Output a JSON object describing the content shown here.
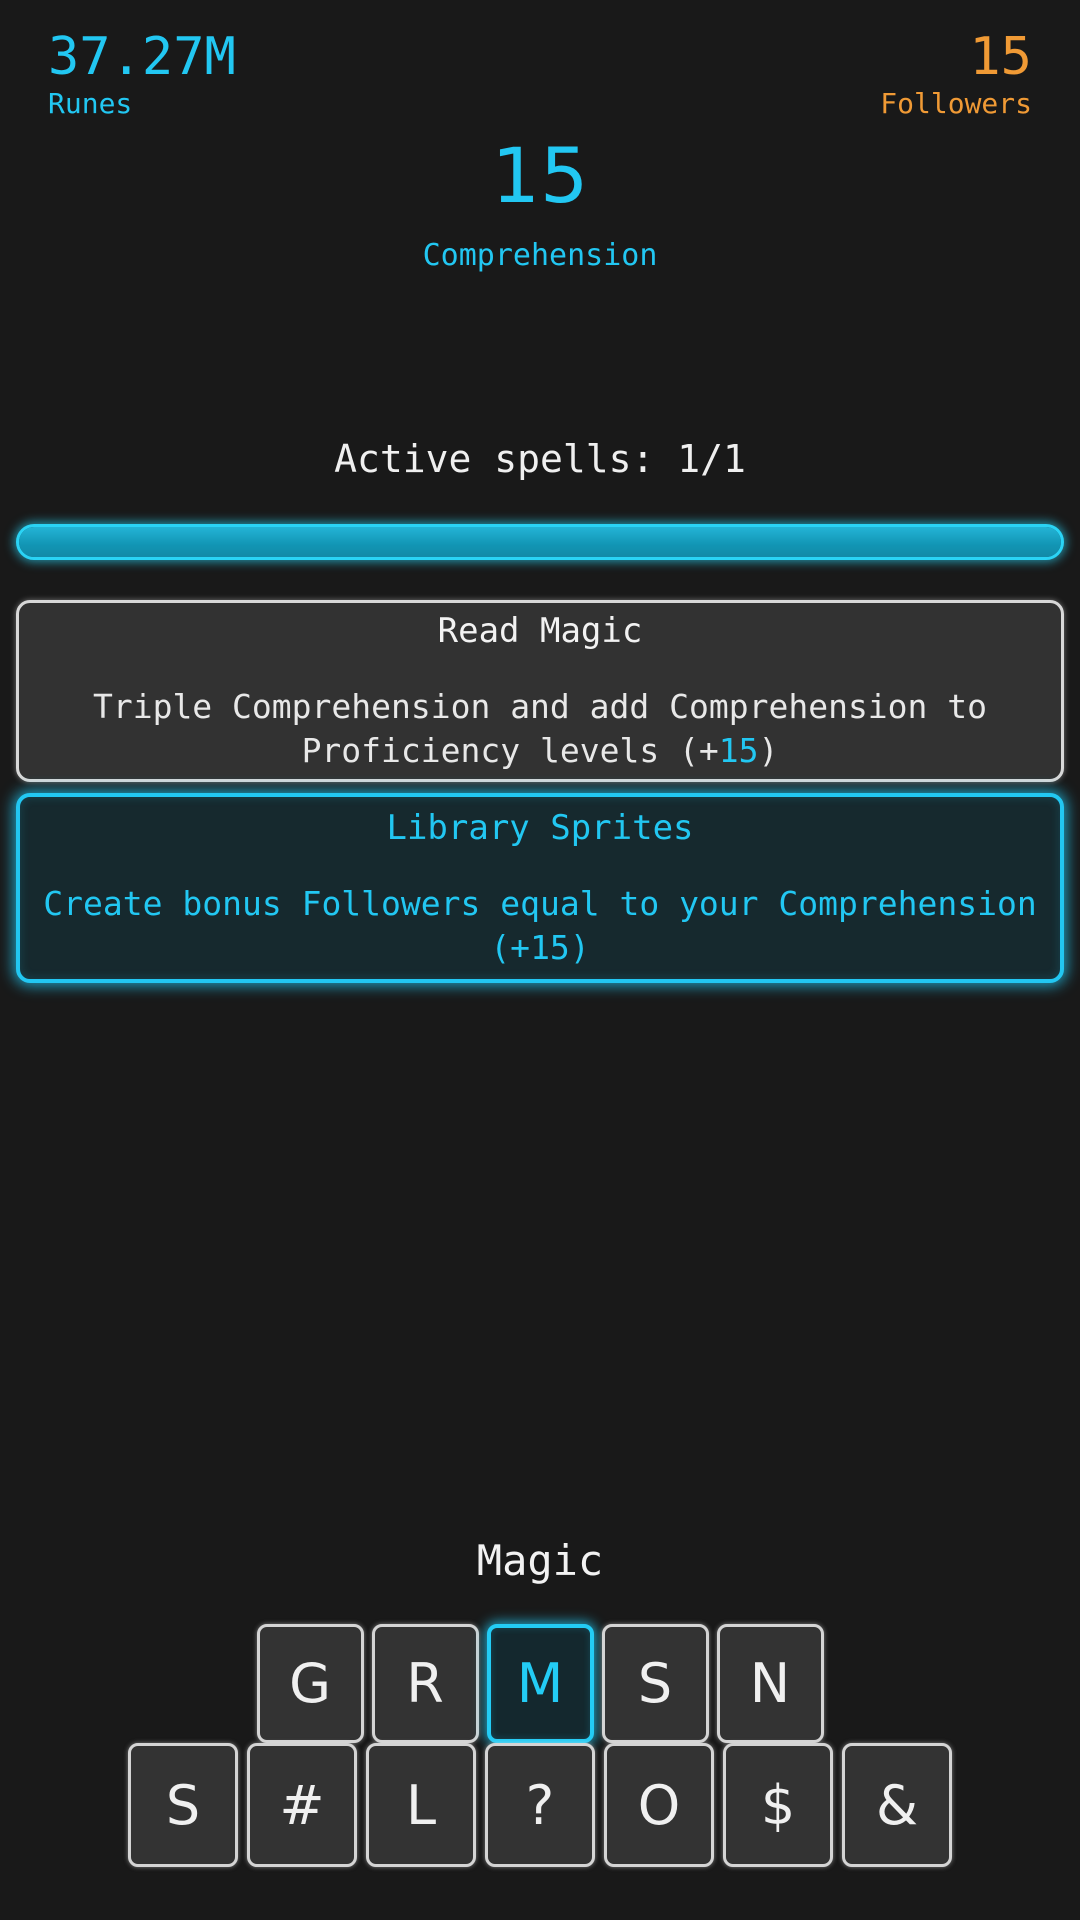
{
  "stats": {
    "left": {
      "value": "37.27M",
      "label": "Runes",
      "color": "#22c7f2"
    },
    "right": {
      "value": "15",
      "label": "Followers",
      "color": "#f09a35"
    }
  },
  "central": {
    "value": "15",
    "label": "Comprehension",
    "color": "#22c7f2"
  },
  "active_spells": {
    "text": "Active spells: 1/1",
    "current": 1,
    "max": 1
  },
  "progress": {
    "percent": 100
  },
  "spells": [
    {
      "name": "Read Magic",
      "description_before": "Triple Comprehension and add Comprehension to Proficiency levels (+",
      "description_highlight": "15",
      "description_after": ")",
      "active": false
    },
    {
      "name": "Library Sprites",
      "description_before": "Create bonus Followers equal to your Comprehension (+",
      "description_highlight": "15",
      "description_after": ")",
      "active": true
    }
  ],
  "keyboard": {
    "title": "Magic",
    "row1": [
      {
        "label": "G",
        "selected": false
      },
      {
        "label": "R",
        "selected": false
      },
      {
        "label": "M",
        "selected": true
      },
      {
        "label": "S",
        "selected": false
      },
      {
        "label": "N",
        "selected": false
      }
    ],
    "row2": [
      {
        "label": "S",
        "selected": false
      },
      {
        "label": "#",
        "selected": false
      },
      {
        "label": "L",
        "selected": false
      },
      {
        "label": "?",
        "selected": false
      },
      {
        "label": "O",
        "selected": false
      },
      {
        "label": "$",
        "selected": false
      },
      {
        "label": "&",
        "selected": false
      }
    ]
  }
}
